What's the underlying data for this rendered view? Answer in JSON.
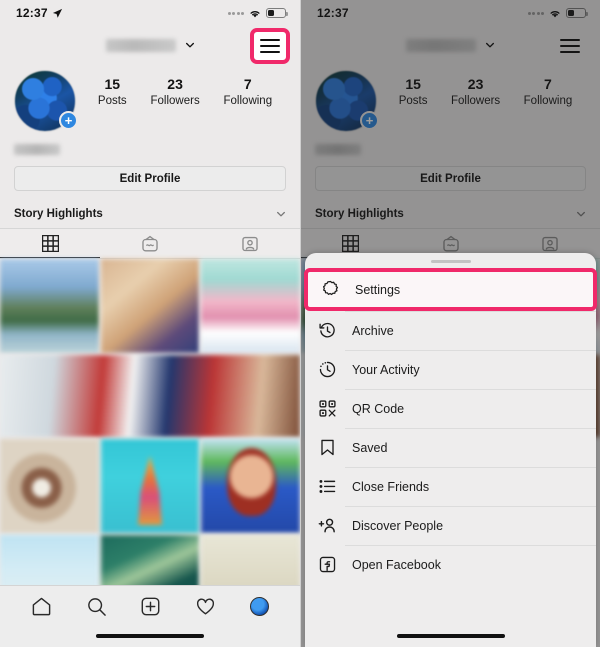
{
  "status_bar": {
    "time": "12:37",
    "location_icon": "location-arrow-icon",
    "signal_icon": "signal-dots-icon",
    "wifi_icon": "wifi-icon",
    "battery_icon": "battery-icon"
  },
  "header": {
    "username_masked": "",
    "chevron_icon": "chevron-down-icon",
    "menu_icon": "hamburger-menu-icon"
  },
  "profile": {
    "avatar_icon": "profile-avatar",
    "add_story_badge": "+",
    "stats": [
      {
        "value": "15",
        "label": "Posts"
      },
      {
        "value": "23",
        "label": "Followers"
      },
      {
        "value": "7",
        "label": "Following"
      }
    ],
    "display_name_masked": "",
    "edit_profile_label": "Edit Profile",
    "story_highlights_label": "Story Highlights",
    "story_highlights_chevron": "chevron-down-icon"
  },
  "content_tabs": [
    {
      "name": "grid-tab",
      "icon": "grid-icon",
      "active": true
    },
    {
      "name": "igtv-tab",
      "icon": "igtv-icon",
      "active": false
    },
    {
      "name": "tagged-tab",
      "icon": "tagged-photos-icon",
      "active": false
    }
  ],
  "photo_grid": [
    {
      "name": "post-landscape",
      "style": "ph-landscape",
      "span": 1
    },
    {
      "name": "post-hat",
      "style": "ph-hat",
      "span": 1
    },
    {
      "name": "post-pink-dress",
      "style": "ph-dress",
      "span": 1
    },
    {
      "name": "post-flag",
      "style": "ph-flag",
      "span": 3
    },
    {
      "name": "post-cotton",
      "style": "ph-cotton",
      "span": 1
    },
    {
      "name": "post-building",
      "style": "ph-building",
      "span": 1
    },
    {
      "name": "post-portrait",
      "style": "ph-woman",
      "span": 1
    },
    {
      "name": "post-sky",
      "style": "ph-sky",
      "span": 1
    },
    {
      "name": "post-teal",
      "style": "ph-teal",
      "span": 1
    },
    {
      "name": "post-cream",
      "style": "ph-cream",
      "span": 1
    }
  ],
  "tab_bar": [
    {
      "name": "home-tab",
      "icon": "home-icon"
    },
    {
      "name": "search-tab",
      "icon": "search-icon"
    },
    {
      "name": "create-tab",
      "icon": "plus-square-icon"
    },
    {
      "name": "activity-tab",
      "icon": "heart-icon"
    },
    {
      "name": "profile-tab",
      "icon": "avatar-icon"
    }
  ],
  "action_sheet": {
    "handle": "drag-handle",
    "items": [
      {
        "label": "Settings",
        "icon": "settings-gear-icon",
        "highlighted": true
      },
      {
        "label": "Archive",
        "icon": "archive-clock-icon",
        "highlighted": false
      },
      {
        "label": "Your Activity",
        "icon": "activity-clock-icon",
        "highlighted": false
      },
      {
        "label": "QR Code",
        "icon": "qr-code-icon",
        "highlighted": false
      },
      {
        "label": "Saved",
        "icon": "bookmark-icon",
        "highlighted": false
      },
      {
        "label": "Close Friends",
        "icon": "close-friends-list-icon",
        "highlighted": false
      },
      {
        "label": "Discover People",
        "icon": "discover-people-icon",
        "highlighted": false
      },
      {
        "label": "Open Facebook",
        "icon": "facebook-icon",
        "highlighted": false
      }
    ]
  },
  "annotation": {
    "highlight_color": "#f0296a",
    "targets": [
      "hamburger-menu-icon",
      "Settings"
    ]
  }
}
